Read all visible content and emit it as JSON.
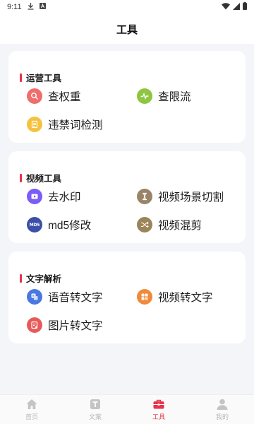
{
  "status_bar": {
    "time": "9:11",
    "download_icon": "download-icon",
    "app_icon": "a-icon",
    "wifi_icon": "wifi-icon",
    "cell_icon": "signal-icon",
    "battery_icon": "battery-icon"
  },
  "header": {
    "title": "工具"
  },
  "sections": [
    {
      "title": "运营工具",
      "items": [
        {
          "label": "查权重",
          "icon": "search-icon",
          "color": "#f06d6d"
        },
        {
          "label": "查限流",
          "icon": "pulse-icon",
          "color": "#8dc63f"
        },
        {
          "label": "违禁词检测",
          "icon": "document-icon",
          "color": "#f4c23d"
        }
      ]
    },
    {
      "title": "视频工具",
      "items": [
        {
          "label": "去水印",
          "icon": "play-icon",
          "color": "#7b5cf6"
        },
        {
          "label": "视频场景切割",
          "icon": "split-icon",
          "color": "#9a8468"
        },
        {
          "label": "md5修改",
          "icon": "md5-icon",
          "color": "#3b4fa8",
          "badge": "MD5"
        },
        {
          "label": "视频混剪",
          "icon": "shuffle-icon",
          "color": "#9a8458"
        }
      ]
    },
    {
      "title": "文字解析",
      "items": [
        {
          "label": "语音转文字",
          "icon": "speech-text-icon",
          "color": "#4a78e0"
        },
        {
          "label": "视频转文字",
          "icon": "video-text-icon",
          "color": "#f08a3a"
        },
        {
          "label": "图片转文字",
          "icon": "image-text-icon",
          "color": "#e85a5a"
        }
      ]
    }
  ],
  "tabbar": {
    "items": [
      {
        "label": "首页",
        "icon": "home-icon",
        "active": false
      },
      {
        "label": "文案",
        "icon": "text-icon",
        "active": false
      },
      {
        "label": "工具",
        "icon": "toolbox-icon",
        "active": true
      },
      {
        "label": "我的",
        "icon": "user-icon",
        "active": false
      }
    ],
    "active_color": "#e8334a",
    "inactive_color": "#b8b8b8"
  }
}
